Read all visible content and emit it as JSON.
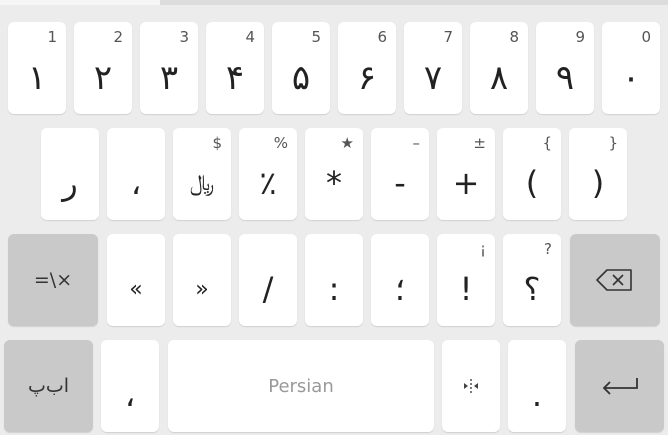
{
  "rows": [
    [
      {
        "main": "۱",
        "sec": "1"
      },
      {
        "main": "۲",
        "sec": "2"
      },
      {
        "main": "۳",
        "sec": "3"
      },
      {
        "main": "۴",
        "sec": "4"
      },
      {
        "main": "۵",
        "sec": "5"
      },
      {
        "main": "۶",
        "sec": "6"
      },
      {
        "main": "۷",
        "sec": "7"
      },
      {
        "main": "۸",
        "sec": "8"
      },
      {
        "main": "۹",
        "sec": "9"
      },
      {
        "main": "۰",
        "sec": "0"
      }
    ],
    [
      {
        "main": "ر",
        "sec": ""
      },
      {
        "main": "،",
        "sec": ""
      },
      {
        "main": "﷼",
        "sec": "$"
      },
      {
        "main": "٪",
        "sec": "%"
      },
      {
        "main": "*",
        "sec": "★"
      },
      {
        "main": "-",
        "sec": "–"
      },
      {
        "main": "+",
        "sec": "±"
      },
      {
        "main": "(",
        "sec": "{"
      },
      {
        "main": ")",
        "sec": "}"
      }
    ],
    [
      {
        "main": "=\\×",
        "sec": ""
      },
      {
        "main": "«",
        "sec": ""
      },
      {
        "main": "»",
        "sec": ""
      },
      {
        "main": "/",
        "sec": ""
      },
      {
        "main": ":",
        "sec": ""
      },
      {
        "main": "؛",
        "sec": ""
      },
      {
        "main": "!",
        "sec": "¡"
      },
      {
        "main": "؟",
        "sec": "?"
      }
    ],
    [
      {
        "main": "اب‌پ",
        "sec": ""
      },
      {
        "main": "،",
        "sec": ""
      },
      {
        "main": "Persian",
        "sec": ""
      },
      {
        "main": "‌",
        "sec": ""
      },
      {
        "main": ".",
        "sec": ""
      }
    ]
  ],
  "icons": {
    "backspace": "backspace-icon",
    "enter": "enter-icon",
    "zwnj": "zero-width-non-joiner-icon"
  },
  "colors": {
    "background": "#ececec",
    "key": "#ffffff",
    "special_key": "#c9c9c9",
    "text": "#222222"
  }
}
